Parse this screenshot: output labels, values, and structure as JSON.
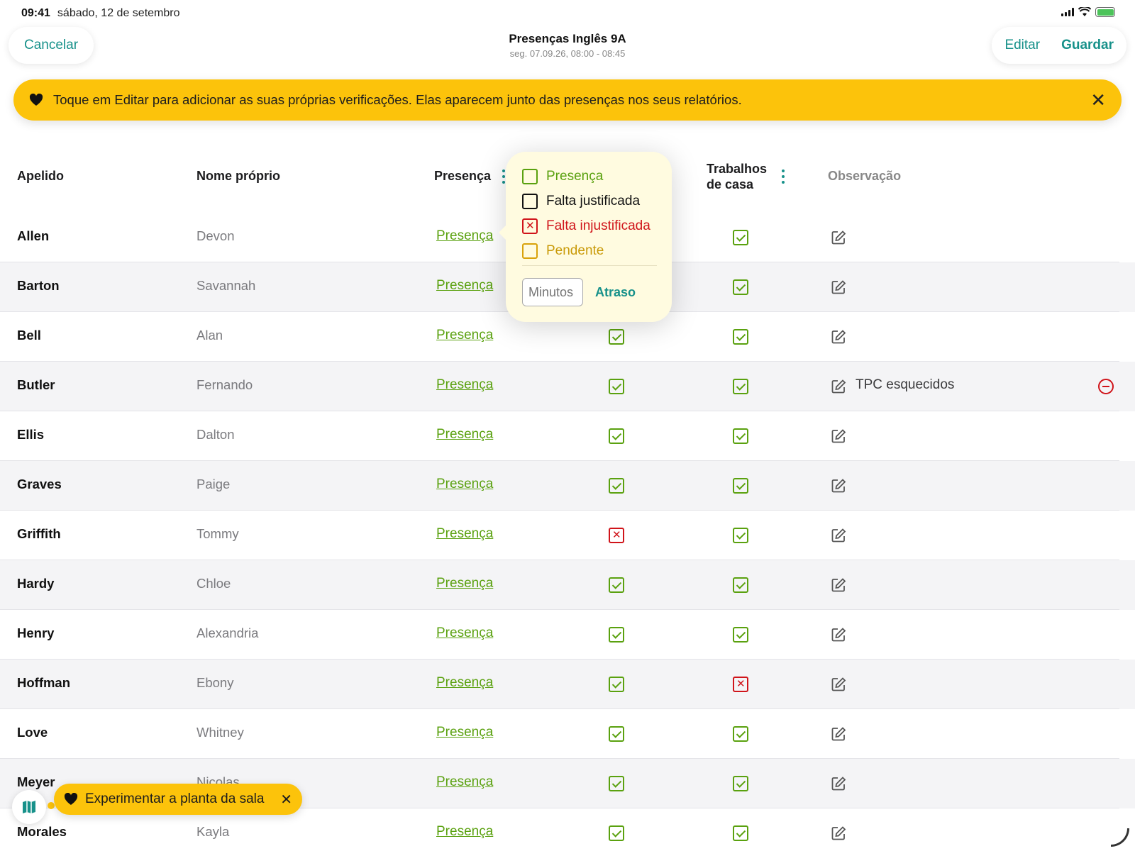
{
  "status_bar": {
    "time": "09:41",
    "date": "sábado, 12 de setembro"
  },
  "nav": {
    "cancel_label": "Cancelar",
    "edit_label": "Editar",
    "save_label": "Guardar",
    "title": "Presenças Inglês 9A",
    "subtitle": "seg. 07.09.26, 08:00 - 08:45"
  },
  "banner": {
    "icon": "heart-icon",
    "text": "Toque em Editar para adicionar as suas próprias verificações. Elas aparecem junto das presenças nos seus relatórios.",
    "close": "✕"
  },
  "columns": {
    "last_name": "Apelido",
    "first_name": "Nome próprio",
    "attendance": "Presença",
    "homework_line1": "Trabalhos",
    "homework_line2": "de casa",
    "note": "Observação"
  },
  "popover": {
    "options": [
      "Presença",
      "Falta justificada",
      "Falta injustificada",
      "Pendente"
    ],
    "option_colors": [
      "#5aa10f",
      "#111111",
      "#d0141a",
      "#d9a20a"
    ],
    "minutes_placeholder": "Minutos",
    "late_label": "Atraso"
  },
  "rows": [
    {
      "last": "Allen",
      "first": "Devon",
      "attendance": "Presença",
      "check": true,
      "homework": true,
      "note": ""
    },
    {
      "last": "Barton",
      "first": "Savannah",
      "attendance": "Presença",
      "check": true,
      "homework": true,
      "note": ""
    },
    {
      "last": "Bell",
      "first": "Alan",
      "attendance": "Presença",
      "check": true,
      "homework": true,
      "note": ""
    },
    {
      "last": "Butler",
      "first": "Fernando",
      "attendance": "Presença",
      "check": true,
      "homework": true,
      "note": "TPC esquecidos"
    },
    {
      "last": "Ellis",
      "first": "Dalton",
      "attendance": "Presença",
      "check": true,
      "homework": true,
      "note": ""
    },
    {
      "last": "Graves",
      "first": "Paige",
      "attendance": "Presença",
      "check": true,
      "homework": true,
      "note": ""
    },
    {
      "last": "Griffith",
      "first": "Tommy",
      "attendance": "Presença",
      "check": false,
      "homework": true,
      "note": ""
    },
    {
      "last": "Hardy",
      "first": "Chloe",
      "attendance": "Presença",
      "check": true,
      "homework": true,
      "note": ""
    },
    {
      "last": "Henry",
      "first": "Alexandria",
      "attendance": "Presença",
      "check": true,
      "homework": true,
      "note": ""
    },
    {
      "last": "Hoffman",
      "first": "Ebony",
      "attendance": "Presença",
      "check": true,
      "homework": false,
      "note": ""
    },
    {
      "last": "Love",
      "first": "Whitney",
      "attendance": "Presença",
      "check": true,
      "homework": true,
      "note": ""
    },
    {
      "last": "Meyer",
      "first": "Nicolas",
      "attendance": "Presença",
      "check": true,
      "homework": true,
      "note": ""
    },
    {
      "last": "Morales",
      "first": "Kayla",
      "attendance": "Presença",
      "check": true,
      "homework": true,
      "note": ""
    }
  ],
  "tip": {
    "text": "Experimentar a planta da sala",
    "close": "✕",
    "icon": "heart-icon",
    "map_icon": "map-icon"
  },
  "colors": {
    "accent": "#17918a",
    "present": "#5aa10f",
    "absent": "#d0141a",
    "banner": "#fcc30b"
  }
}
